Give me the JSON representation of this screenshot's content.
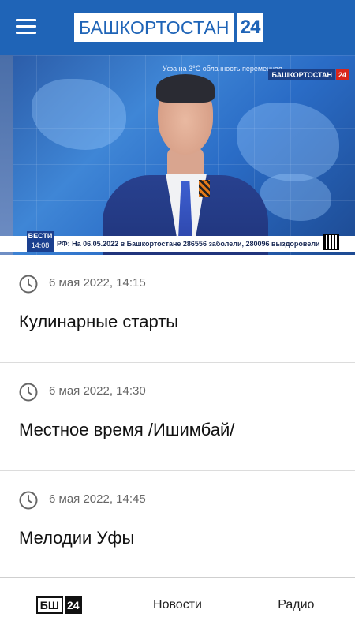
{
  "header": {
    "logo_text": "БАШКОРТОСТАН",
    "logo_number": "24",
    "brand_color": "#1f64b7"
  },
  "video": {
    "top_caption": "Уфа на 3°С облачность переменная",
    "channel_logo_text": "БАШКОРТОСТАН",
    "channel_logo_number": "24",
    "news_label": "ВЕСТИ",
    "news_time": "14:08",
    "ticker": "РФ: На 06.05.2022 в Башкортостане 286556 заболели, 280096 выздоровели"
  },
  "programs": [
    {
      "time": "6 мая 2022, 14:15",
      "title": "Кулинарные старты"
    },
    {
      "time": "6 мая 2022, 14:30",
      "title": "Местное время /Ишимбай/"
    },
    {
      "time": "6 мая 2022, 14:45",
      "title": "Мелодии Уфы"
    }
  ],
  "bottom_nav": {
    "home_logo_a": "БШ",
    "home_logo_b": "24",
    "news": "Новости",
    "radio": "Радио"
  },
  "icons": {
    "menu": "hamburger-icon",
    "clock": "clock-icon"
  }
}
